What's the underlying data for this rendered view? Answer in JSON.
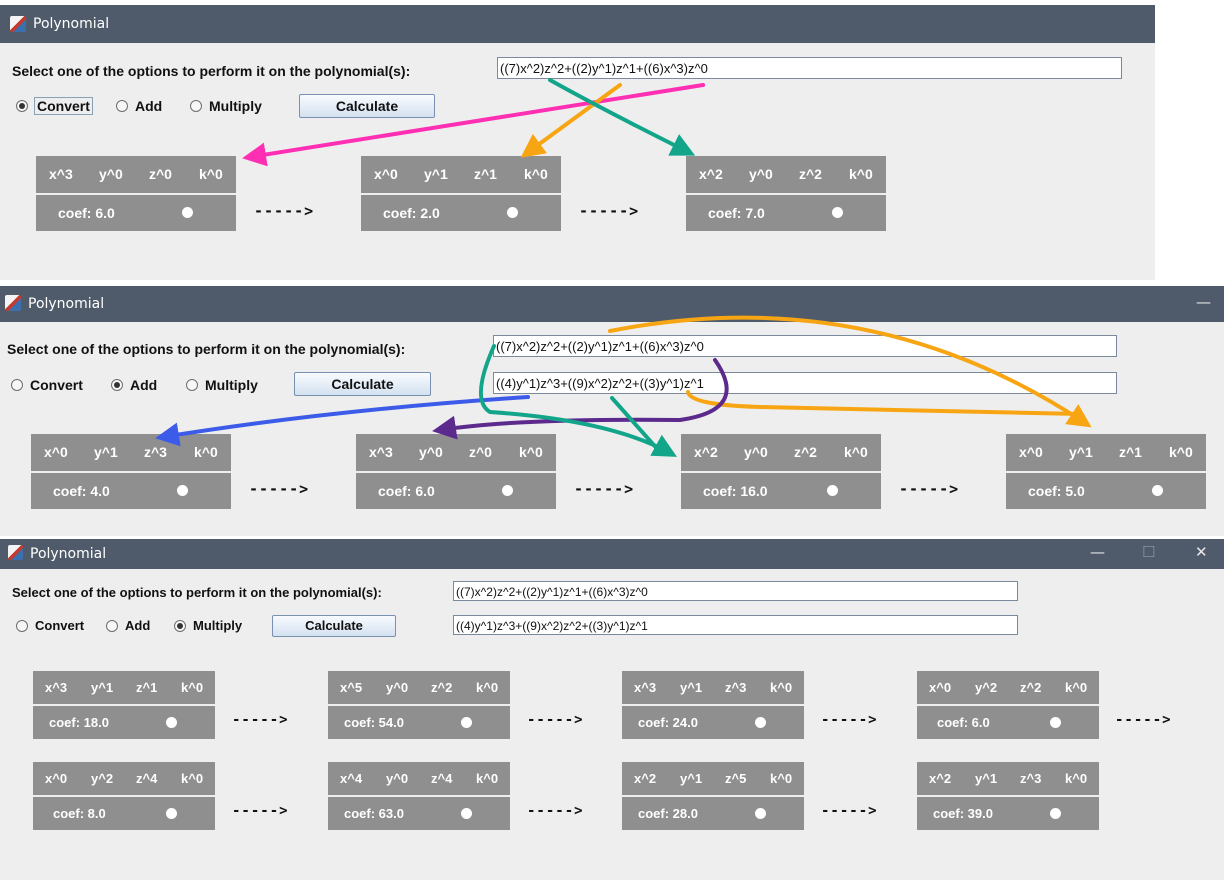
{
  "window_title": "Polynomial",
  "prompt": "Select one of the options to perform it on the polynomial(s):",
  "options": [
    "Convert",
    "Add",
    "Multiply"
  ],
  "calculate_label": "Calculate",
  "arrow_text": "----->",
  "window_controls": {
    "minimize": "—",
    "maximize": "☐",
    "close": "✕"
  },
  "panel1": {
    "selected": "Convert",
    "poly1": "((7)x^2)z^2+((2)y^1)z^1+((6)x^3)z^0",
    "nodes": [
      {
        "x": "x^3",
        "y": "y^0",
        "z": "z^0",
        "k": "k^0",
        "coef": "coef: 6.0"
      },
      {
        "x": "x^0",
        "y": "y^1",
        "z": "z^1",
        "k": "k^0",
        "coef": "coef: 2.0"
      },
      {
        "x": "x^2",
        "y": "y^0",
        "z": "z^2",
        "k": "k^0",
        "coef": "coef: 7.0"
      }
    ]
  },
  "panel2": {
    "selected": "Add",
    "poly1": "((7)x^2)z^2+((2)y^1)z^1+((6)x^3)z^0",
    "poly2": "((4)y^1)z^3+((9)x^2)z^2+((3)y^1)z^1",
    "nodes": [
      {
        "x": "x^0",
        "y": "y^1",
        "z": "z^3",
        "k": "k^0",
        "coef": "coef: 4.0"
      },
      {
        "x": "x^3",
        "y": "y^0",
        "z": "z^0",
        "k": "k^0",
        "coef": "coef: 6.0"
      },
      {
        "x": "x^2",
        "y": "y^0",
        "z": "z^2",
        "k": "k^0",
        "coef": "coef: 16.0"
      },
      {
        "x": "x^0",
        "y": "y^1",
        "z": "z^1",
        "k": "k^0",
        "coef": "coef: 5.0"
      }
    ]
  },
  "panel3": {
    "selected": "Multiply",
    "poly1": "((7)x^2)z^2+((2)y^1)z^1+((6)x^3)z^0",
    "poly2": "((4)y^1)z^3+((9)x^2)z^2+((3)y^1)z^1",
    "nodes": [
      {
        "x": "x^3",
        "y": "y^1",
        "z": "z^1",
        "k": "k^0",
        "coef": "coef: 18.0"
      },
      {
        "x": "x^5",
        "y": "y^0",
        "z": "z^2",
        "k": "k^0",
        "coef": "coef: 54.0"
      },
      {
        "x": "x^3",
        "y": "y^1",
        "z": "z^3",
        "k": "k^0",
        "coef": "coef: 24.0"
      },
      {
        "x": "x^0",
        "y": "y^2",
        "z": "z^2",
        "k": "k^0",
        "coef": "coef: 6.0"
      },
      {
        "x": "x^0",
        "y": "y^2",
        "z": "z^4",
        "k": "k^0",
        "coef": "coef: 8.0"
      },
      {
        "x": "x^4",
        "y": "y^0",
        "z": "z^4",
        "k": "k^0",
        "coef": "coef: 63.0"
      },
      {
        "x": "x^2",
        "y": "y^1",
        "z": "z^5",
        "k": "k^0",
        "coef": "coef: 28.0"
      },
      {
        "x": "x^2",
        "y": "y^1",
        "z": "z^3",
        "k": "k^0",
        "coef": "coef: 39.0"
      }
    ]
  },
  "colors": {
    "titlebar": "#4f5b6a",
    "node": "#8f8f8f",
    "annotation_pink": "#ff2fb4",
    "annotation_orange": "#f7a513",
    "annotation_teal": "#12a58a",
    "annotation_purple": "#5b2a8c",
    "annotation_blue": "#3b5be8"
  }
}
